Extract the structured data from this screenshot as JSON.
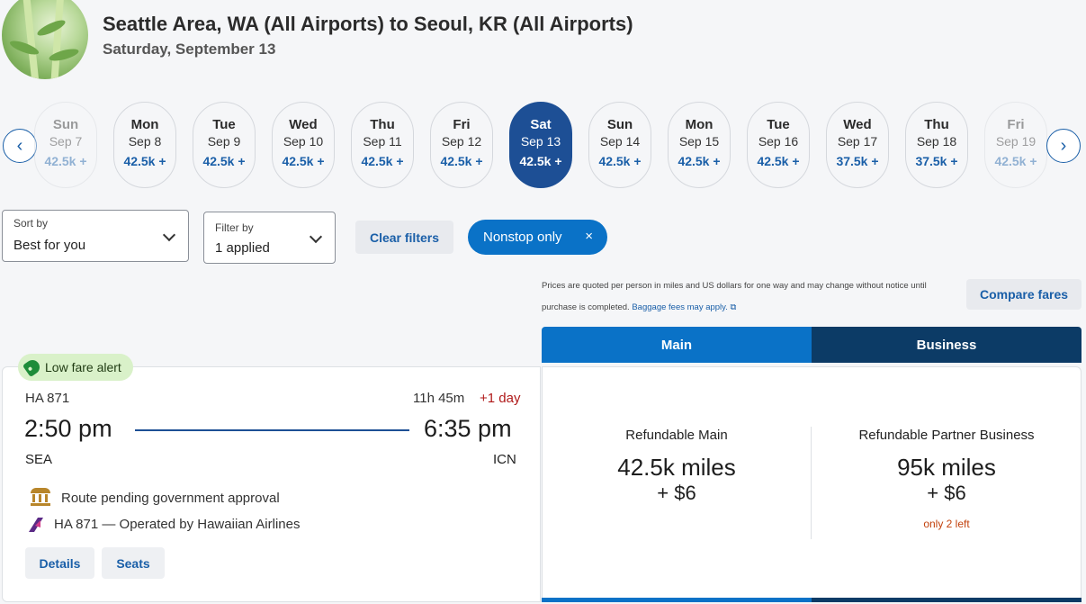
{
  "header": {
    "title": "Seattle Area, WA (All Airports) to Seoul, KR (All Airports)",
    "date": "Saturday, September 13"
  },
  "date_strip": {
    "days": [
      {
        "dow": "Sun",
        "date": "Sep 7",
        "price": "42.5k +",
        "state": "faded"
      },
      {
        "dow": "Mon",
        "date": "Sep 8",
        "price": "42.5k +",
        "state": "normal"
      },
      {
        "dow": "Tue",
        "date": "Sep 9",
        "price": "42.5k +",
        "state": "normal"
      },
      {
        "dow": "Wed",
        "date": "Sep 10",
        "price": "42.5k +",
        "state": "normal"
      },
      {
        "dow": "Thu",
        "date": "Sep 11",
        "price": "42.5k +",
        "state": "normal"
      },
      {
        "dow": "Fri",
        "date": "Sep 12",
        "price": "42.5k +",
        "state": "normal"
      },
      {
        "dow": "Sat",
        "date": "Sep 13",
        "price": "42.5k +",
        "state": "selected"
      },
      {
        "dow": "Sun",
        "date": "Sep 14",
        "price": "42.5k +",
        "state": "normal"
      },
      {
        "dow": "Mon",
        "date": "Sep 15",
        "price": "42.5k +",
        "state": "normal"
      },
      {
        "dow": "Tue",
        "date": "Sep 16",
        "price": "42.5k +",
        "state": "normal"
      },
      {
        "dow": "Wed",
        "date": "Sep 17",
        "price": "37.5k +",
        "state": "normal"
      },
      {
        "dow": "Thu",
        "date": "Sep 18",
        "price": "37.5k +",
        "state": "normal"
      },
      {
        "dow": "Fri",
        "date": "Sep 19",
        "price": "42.5k +",
        "state": "faded"
      }
    ],
    "prev_icon": "chevron-left-icon",
    "next_icon": "chevron-right-icon"
  },
  "filters": {
    "sort_label": "Sort by",
    "sort_value": "Best for you",
    "filter_label": "Filter by",
    "filter_value": "1 applied",
    "clear_label": "Clear filters",
    "chip_label": "Nonstop only",
    "chip_close": "×"
  },
  "disclaimer": {
    "text": "Prices are quoted per person in miles and US dollars for one way and may change without notice until purchase is completed.",
    "link": "Baggage fees may apply."
  },
  "compare_label": "Compare fares",
  "tabs": {
    "main": "Main",
    "business": "Business"
  },
  "flight": {
    "badge": "Low fare alert",
    "number": "HA 871",
    "duration": "11h 45m",
    "plus_day": "+1 day",
    "depart_time": "2:50 pm",
    "arrive_time": "6:35 pm",
    "depart_code": "SEA",
    "arrive_code": "ICN",
    "pending_note": "Route pending government approval",
    "operated_by": "HA 871 — Operated by Hawaiian Airlines",
    "details_label": "Details",
    "seats_label": "Seats"
  },
  "fares": {
    "main": {
      "name": "Refundable Main",
      "miles": "42.5k miles",
      "cash": "+ $6"
    },
    "business": {
      "name": "Refundable Partner Business",
      "miles": "95k miles",
      "cash": "+ $6",
      "availability": "only 2 left"
    }
  },
  "colors": {
    "primary_blue": "#0a72c7",
    "selected_day": "#1d4f95",
    "business_navy": "#0c3b66",
    "alert_green": "#d9f1c9",
    "warning_orange": "#c2410c",
    "plus_day_red": "#b01a1a"
  }
}
